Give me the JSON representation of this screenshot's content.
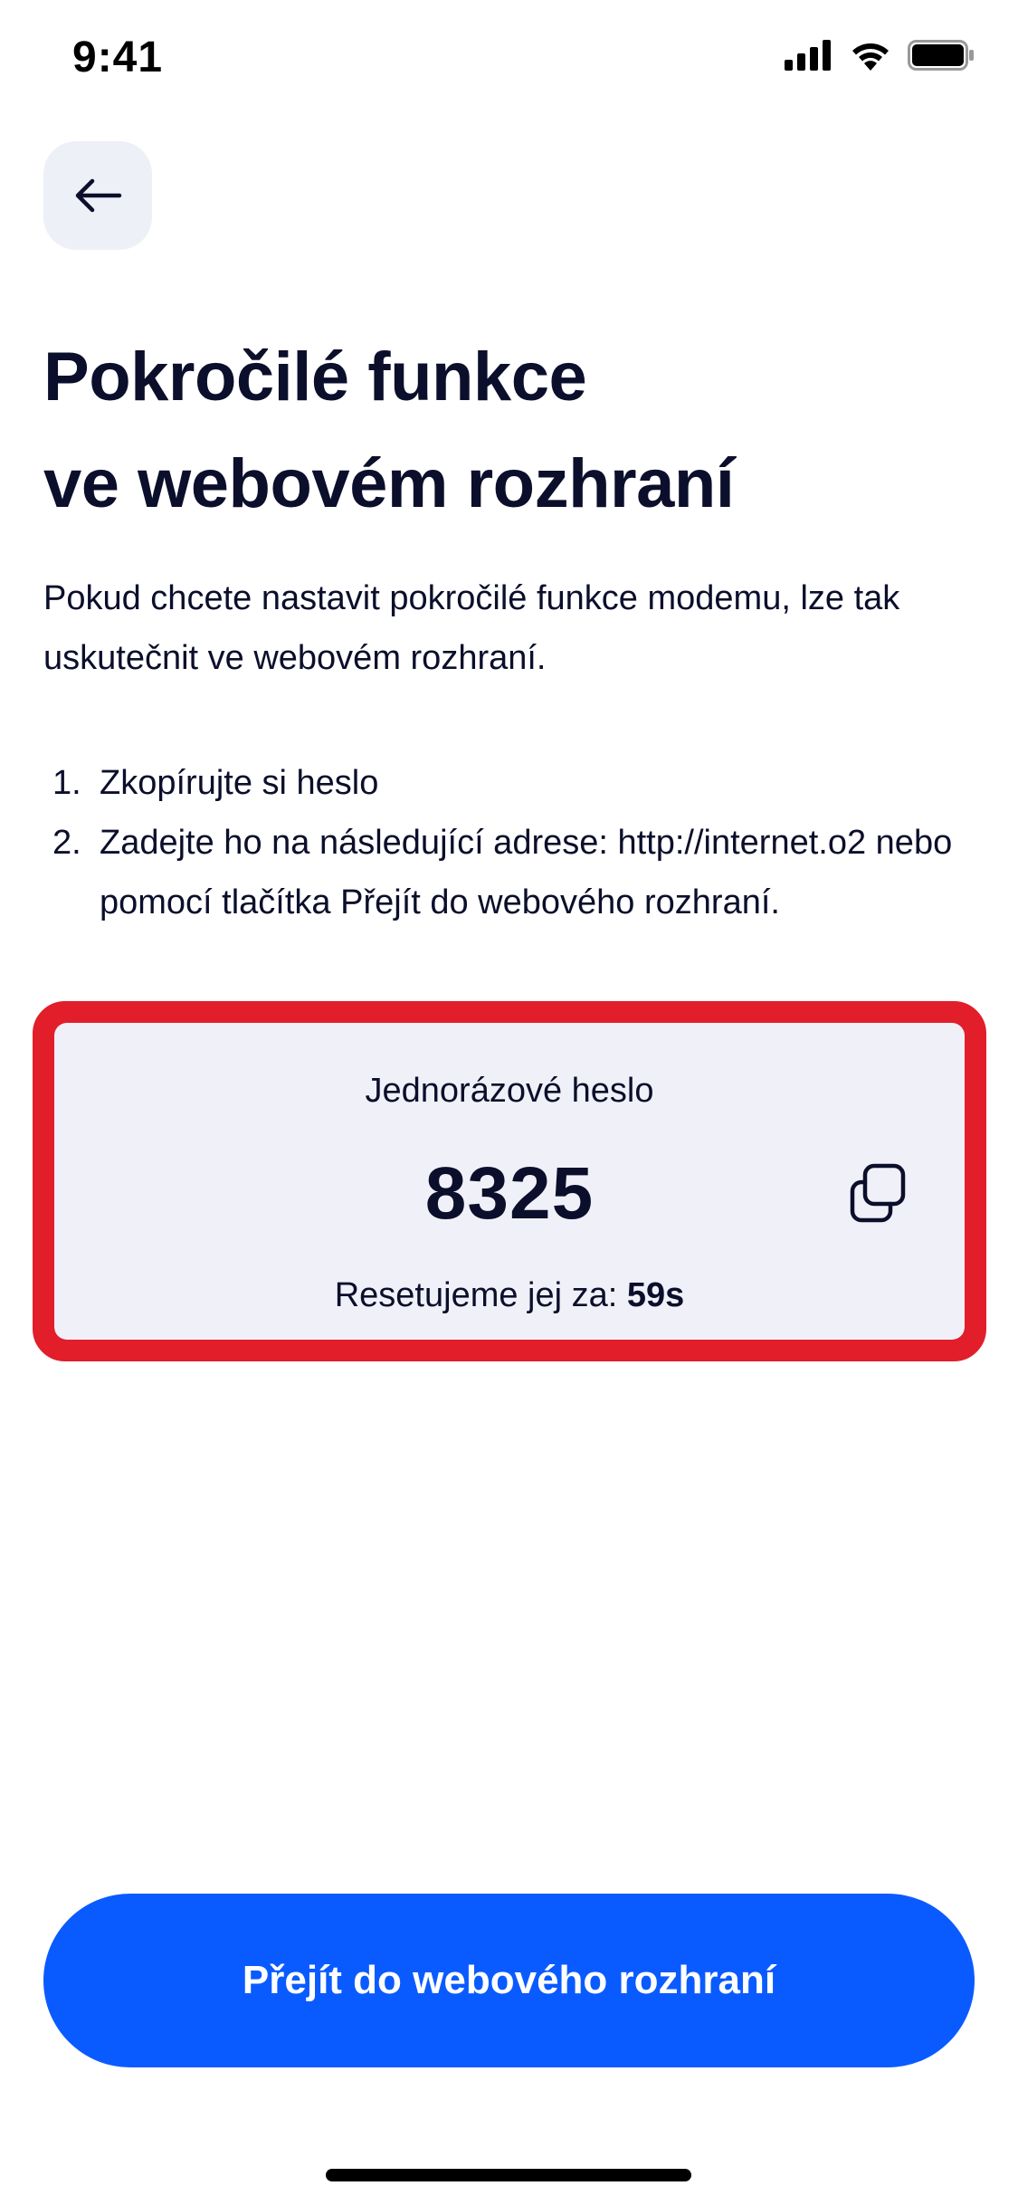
{
  "status_bar": {
    "time": "9:41"
  },
  "header": {
    "back_icon": "arrow-left-icon",
    "title_line1": "Pokročilé funkce",
    "title_line2": "ve webovém rozhraní"
  },
  "intro": {
    "text": "Pokud chcete nastavit pokročilé funkce modemu, lze tak uskutečnit ve webovém rozhraní."
  },
  "steps": [
    {
      "num": "1.",
      "text": "Zkopírujte si heslo"
    },
    {
      "num": "2.",
      "text": "Zadejte ho na následující  adrese: http://internet.o2 nebo pomocí tlačítka Přejít do webového rozhraní."
    }
  ],
  "password_card": {
    "label": "Jednorázové heslo",
    "code": "8325",
    "copy_icon": "copy-icon",
    "reset_prefix": "Resetujeme jej za: ",
    "reset_value": "59s"
  },
  "primary_button": {
    "label": "Přejít do webového rozhraní"
  },
  "colors": {
    "primary": "#0a5bff",
    "highlight": "#e21e2a",
    "card_background": "#f0f1f8",
    "text": "#0b0f2b"
  }
}
